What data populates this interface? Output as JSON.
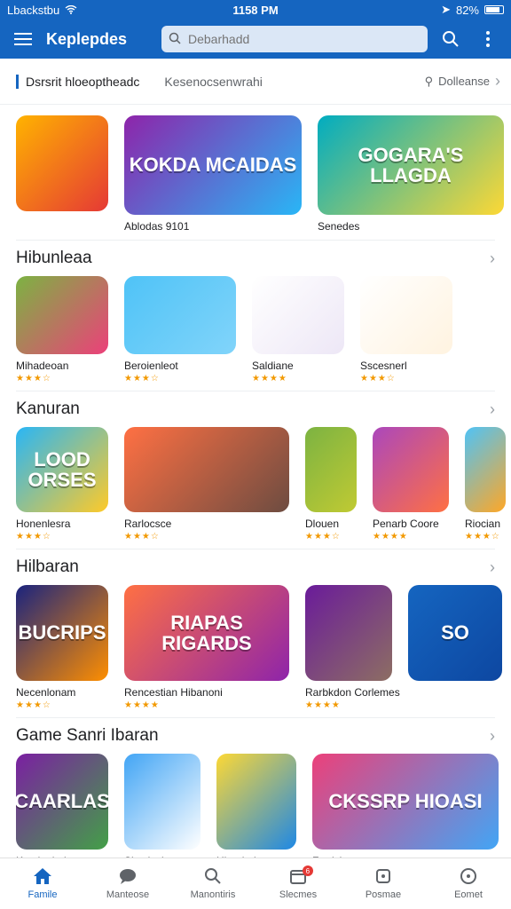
{
  "status": {
    "carrier": "Lbackstbu",
    "time": "1158 PM",
    "battery": "82%"
  },
  "app_bar": {
    "title": "Keplepdes",
    "search_placeholder": "Debarhadd"
  },
  "tabs": {
    "active": "Dsrsrit hloeoptheadc",
    "second": "Kesenocsenwrahi",
    "filter": "Dolleanse"
  },
  "featured": [
    {
      "label": "",
      "art": "",
      "colors": [
        "#ffb300",
        "#e53935"
      ]
    },
    {
      "label": "Ablodas 9101",
      "art": "KOKDA MCAIDAS",
      "colors": [
        "#8e24aa",
        "#29b6f6"
      ]
    },
    {
      "label": "Senedes",
      "art": "GOGARA'S LLAGDA",
      "colors": [
        "#00acc1",
        "#fdd835"
      ]
    }
  ],
  "sections": [
    {
      "title": "Hibunleaa",
      "cards": [
        {
          "label": "Mihadeoan",
          "stars": "★★★☆",
          "colors": [
            "#7cb342",
            "#ec407a"
          ],
          "art": ""
        },
        {
          "label": "Beroienleot",
          "stars": "★★★☆",
          "colors": [
            "#4fc3f7",
            "#81d4fa"
          ],
          "art": ""
        },
        {
          "label": "Saldiane",
          "stars": "★★★★",
          "colors": [
            "#ffffff",
            "#ede7f6"
          ],
          "art": ""
        },
        {
          "label": "Sscesnerl",
          "stars": "★★★☆",
          "colors": [
            "#ffffff",
            "#fff3e0"
          ],
          "art": ""
        }
      ]
    },
    {
      "title": "Kanuran",
      "cards": [
        {
          "label": "Honenlesra",
          "stars": "★★★☆",
          "colors": [
            "#29b6f6",
            "#ffca28"
          ],
          "art": "LOOD ORSES"
        },
        {
          "label": "Rarlocsce",
          "stars": "★★★☆",
          "colors": [
            "#ff7043",
            "#6d4c41"
          ],
          "art": ""
        },
        {
          "label": "Dlouen",
          "stars": "★★★☆",
          "colors": [
            "#7cb342",
            "#c0ca33"
          ],
          "art": ""
        },
        {
          "label": "Penarb Coore",
          "stars": "★★★★",
          "colors": [
            "#ab47bc",
            "#ff7043"
          ],
          "art": ""
        },
        {
          "label": "Riocian",
          "stars": "★★★☆",
          "colors": [
            "#4fc3f7",
            "#ffa726"
          ],
          "art": ""
        }
      ]
    },
    {
      "title": "Hilbaran",
      "cards": [
        {
          "label": "Necenlonam",
          "stars": "★★★☆",
          "colors": [
            "#1a237e",
            "#ff8f00"
          ],
          "art": "BUCRIPS"
        },
        {
          "label": "Rencestian Hibanoni",
          "stars": "★★★★",
          "colors": [
            "#ff7043",
            "#8e24aa"
          ],
          "art": "RIAPAS RIGARDS"
        },
        {
          "label": "Rarbkdon Corlemes",
          "stars": "★★★★",
          "colors": [
            "#6a1b9a",
            "#8d6e63"
          ],
          "art": ""
        },
        {
          "label": "",
          "stars": "",
          "colors": [
            "#1565c0",
            "#0d47a1"
          ],
          "art": "SO"
        }
      ]
    },
    {
      "title": "Game Sanri Ibaran",
      "cards": [
        {
          "label": "Kaptienbak",
          "stars": "",
          "colors": [
            "#7b1fa2",
            "#43a047"
          ],
          "art": "CAARLAS"
        },
        {
          "label": "Sbccleck",
          "stars": "",
          "colors": [
            "#42a5f5",
            "#ffffff"
          ],
          "art": ""
        },
        {
          "label": "Hheobelran",
          "stars": "",
          "colors": [
            "#fdd835",
            "#1e88e5"
          ],
          "art": ""
        },
        {
          "label": "Fordcla",
          "stars": "",
          "colors": [
            "#ec407a",
            "#42a5f5"
          ],
          "art": "CKSSRP HIOASI"
        }
      ]
    }
  ],
  "bottom_nav": [
    {
      "label": "Famile",
      "icon": "home-icon",
      "active": true
    },
    {
      "label": "Manteose",
      "icon": "chat-icon",
      "active": false
    },
    {
      "label": "Manontiris",
      "icon": "search-icon",
      "active": false
    },
    {
      "label": "Slecmes",
      "icon": "calendar-icon",
      "active": false,
      "badge": "6"
    },
    {
      "label": "Posmae",
      "icon": "box-icon",
      "active": false
    },
    {
      "label": "Eomet",
      "icon": "circle-icon",
      "active": false
    }
  ],
  "colors": {
    "primary": "#1565c0",
    "star": "#f29900"
  }
}
